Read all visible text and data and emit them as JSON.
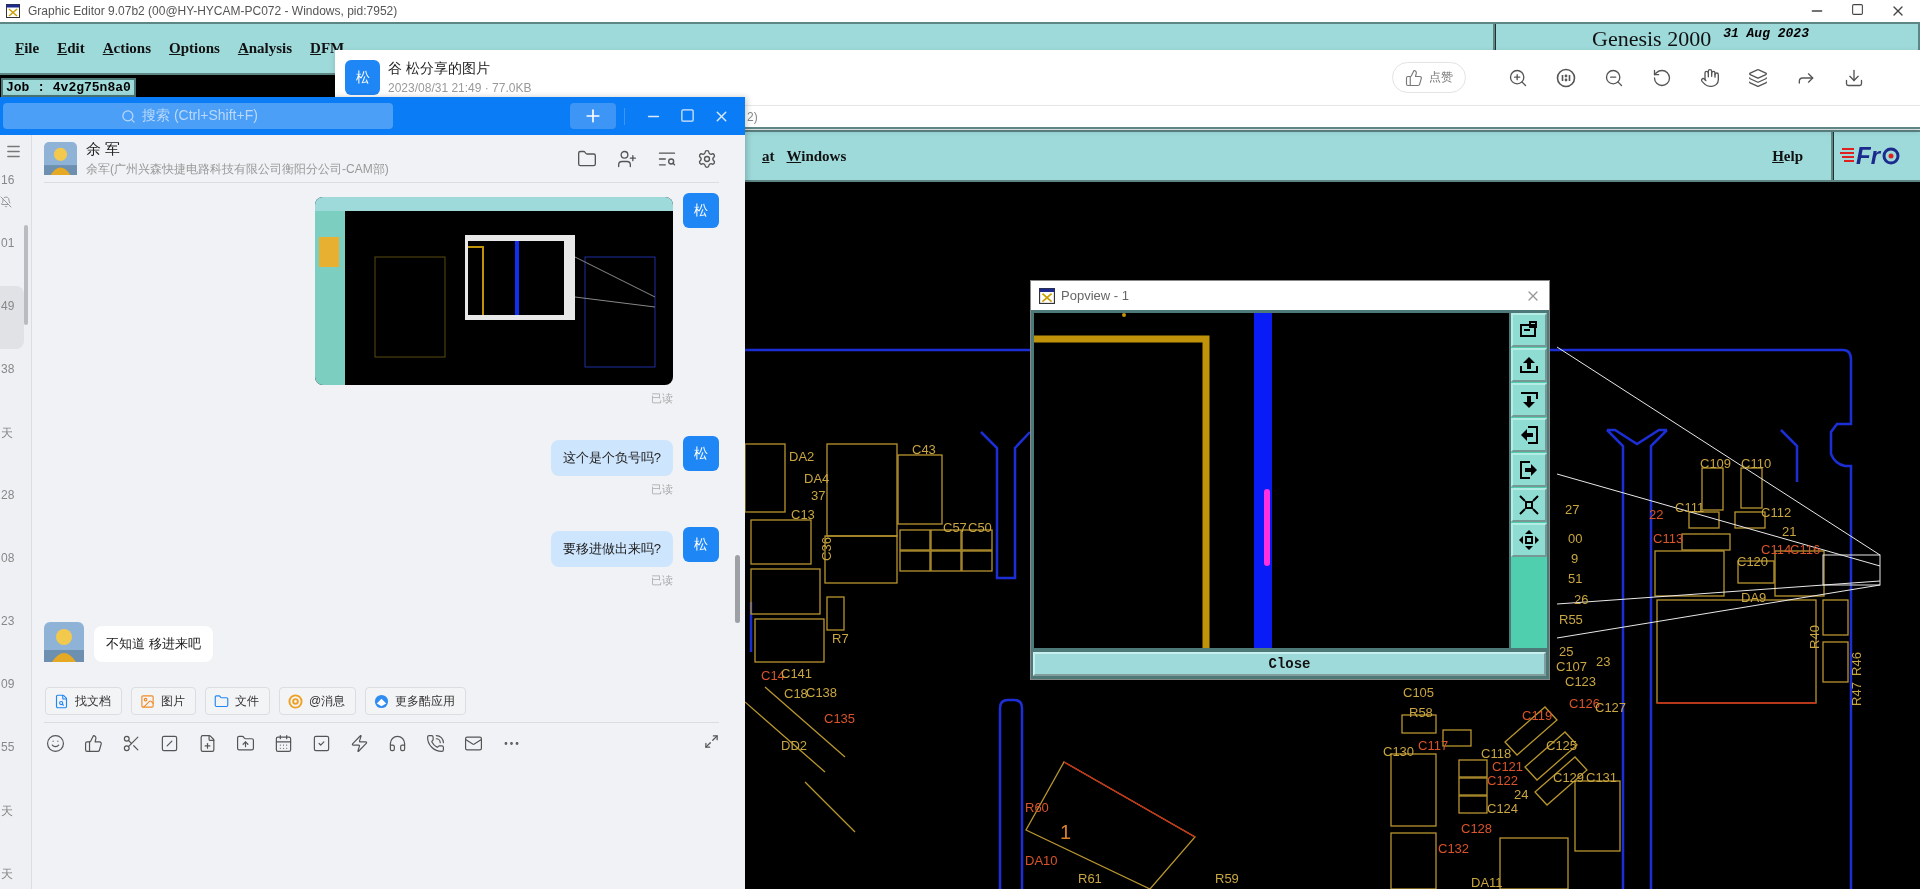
{
  "background_window": {
    "title": "Graphic Editor 9.07b2 (00@HY-HYCAM-PC072 - Windows, pid:7952)",
    "menu": [
      "File",
      "Edit",
      "Actions",
      "Options",
      "Analysis",
      "DFM"
    ],
    "brand": "Genesis 2000",
    "date": "31 Aug 2023",
    "job": "Job : 4v2g75n8a0"
  },
  "image_viewer": {
    "avatar": "松",
    "title": "谷 松分享的图片",
    "meta": "2023/08/31 21:49 · 77.0KB",
    "like": "点赞",
    "fragment": "2)"
  },
  "editor_menu": {
    "items": [
      "at",
      "Windows"
    ],
    "help": "Help",
    "logo": "Fr"
  },
  "pcb_labels": [
    {
      "text": "DA2",
      "color": "#c9a641"
    },
    {
      "text": "DA4",
      "color": "#c9a641"
    },
    {
      "text": "37",
      "color": "#c9a641"
    },
    {
      "text": "C43",
      "color": "#c9a641"
    },
    {
      "text": "C13",
      "color": "#c9a641"
    },
    {
      "text": "C36",
      "color": "#c9a641"
    },
    {
      "text": "C57",
      "color": "#c9a641"
    },
    {
      "text": "C50",
      "color": "#c9a641"
    },
    {
      "text": "R7",
      "color": "#c9a641"
    },
    {
      "text": "C14",
      "color": "#d9542a"
    },
    {
      "text": "C141",
      "color": "#c9a641"
    },
    {
      "text": "C18",
      "color": "#c9a641"
    },
    {
      "text": "C138",
      "color": "#c9a641"
    },
    {
      "text": "C135",
      "color": "#d9542a"
    },
    {
      "text": "DD2",
      "color": "#c9a641"
    },
    {
      "text": "C109",
      "color": "#c9a641"
    },
    {
      "text": "C110",
      "color": "#c9a641"
    },
    {
      "text": "27",
      "color": "#c9a641"
    },
    {
      "text": "22",
      "color": "#d9542a"
    },
    {
      "text": "C111",
      "color": "#c9a641"
    },
    {
      "text": "C112",
      "color": "#c9a641"
    },
    {
      "text": "21",
      "color": "#c9a641"
    },
    {
      "text": "C113",
      "color": "#d9542a"
    },
    {
      "text": "C114",
      "color": "#d9542a"
    },
    {
      "text": "C116",
      "color": "#d9542a"
    },
    {
      "text": "00",
      "color": "#c9a641"
    },
    {
      "text": "9",
      "color": "#c9a641"
    },
    {
      "text": "51",
      "color": "#c9a641"
    },
    {
      "text": "C120",
      "color": "#c9a641"
    },
    {
      "text": "26",
      "color": "#c9a641"
    },
    {
      "text": "DA9",
      "color": "#c9a641"
    },
    {
      "text": "R55",
      "color": "#c9a641"
    },
    {
      "text": "25",
      "color": "#c9a641"
    },
    {
      "text": "C107",
      "color": "#c9a641"
    },
    {
      "text": "23",
      "color": "#c9a641"
    },
    {
      "text": "C123",
      "color": "#c9a641"
    },
    {
      "text": "C105",
      "color": "#c9a641"
    },
    {
      "text": "R58",
      "color": "#c9a641"
    },
    {
      "text": "C126",
      "color": "#d9542a"
    },
    {
      "text": "C127",
      "color": "#c9a641"
    },
    {
      "text": "C119",
      "color": "#d9542a"
    },
    {
      "text": "C125",
      "color": "#c9a641"
    },
    {
      "text": "C130",
      "color": "#c9a641"
    },
    {
      "text": "C117",
      "color": "#d9542a"
    },
    {
      "text": "C118",
      "color": "#c9a641"
    },
    {
      "text": "C121",
      "color": "#d9542a"
    },
    {
      "text": "C122",
      "color": "#d9542a"
    },
    {
      "text": "C129",
      "color": "#c9a641"
    },
    {
      "text": "C131",
      "color": "#c9a641"
    },
    {
      "text": "24",
      "color": "#c9a641"
    },
    {
      "text": "C124",
      "color": "#c9a641"
    },
    {
      "text": "C128",
      "color": "#d9542a"
    },
    {
      "text": "C132",
      "color": "#d9542a"
    },
    {
      "text": "R60",
      "color": "#d9542a"
    },
    {
      "text": "1",
      "color": "#d9802a"
    },
    {
      "text": "DA10",
      "color": "#d9542a"
    },
    {
      "text": "R61",
      "color": "#c9a641"
    },
    {
      "text": "R59",
      "color": "#c9a641"
    },
    {
      "text": "DA11",
      "color": "#c9a641"
    },
    {
      "text": "R40",
      "color": "#c9a641"
    },
    {
      "text": "R47",
      "color": "#c9a641"
    },
    {
      "text": "R46",
      "color": "#c9a641"
    }
  ],
  "popview": {
    "title": "Popview - 1",
    "close": "Close"
  },
  "chat": {
    "search_placeholder": "搜索 (Ctrl+Shift+F)",
    "sidebar": [
      {
        "text": "16",
        "selected": false,
        "muted": true
      },
      {
        "text": "01",
        "selected": false,
        "muted": false
      },
      {
        "text": "49",
        "selected": true,
        "muted": false
      },
      {
        "text": "38",
        "selected": false,
        "muted": false
      },
      {
        "text": "天",
        "selected": false,
        "muted": false
      },
      {
        "text": "28",
        "selected": false,
        "muted": false
      },
      {
        "text": "08",
        "selected": false,
        "muted": false
      },
      {
        "text": "23",
        "selected": false,
        "muted": false
      },
      {
        "text": "09",
        "selected": false,
        "muted": false
      },
      {
        "text": "55",
        "selected": false,
        "muted": false
      },
      {
        "text": "天",
        "selected": false,
        "muted": false
      },
      {
        "text": "天",
        "selected": false,
        "muted": false
      }
    ],
    "contact": {
      "name": "余 军",
      "detail": "余军(广州兴森快捷电路科技有限公司衡阳分公司-CAM部)"
    },
    "messages": [
      {
        "kind": "sent_image",
        "avatar": "松",
        "status": "已读"
      },
      {
        "kind": "sent_text",
        "text": "这个是个负号吗?",
        "avatar": "松",
        "status": "已读"
      },
      {
        "kind": "sent_text",
        "text": "要移进做出来吗?",
        "avatar": "松",
        "status": "已读"
      },
      {
        "kind": "received_text",
        "text": "不知道  移进来吧"
      }
    ],
    "quick_actions": [
      "找文档",
      "图片",
      "文件",
      "@消息",
      "更多酷应用"
    ]
  }
}
